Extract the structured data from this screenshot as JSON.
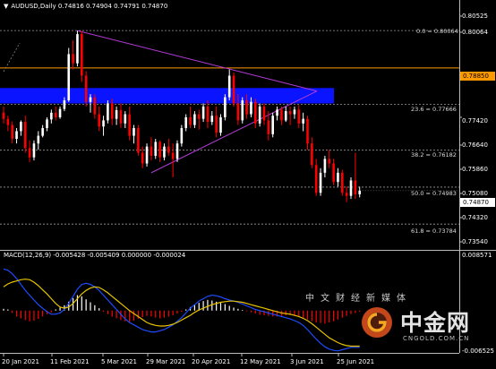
{
  "chart_header": {
    "symbol_timeframe": "AUDUSD,Daily",
    "ohlc": "0.74816 0.74904 0.74791 0.74870"
  },
  "macd_header": "MACD(12,26,9) -0.005428 -0.005409 0.000000 -0.000024",
  "price_axis": {
    "ticks": [
      "0.80525",
      "0.80064",
      "0.78850",
      "0.77420",
      "0.76640",
      "0.75860",
      "0.75080",
      "0.74870",
      "0.74320",
      "0.73540"
    ],
    "current_price": "0.74870",
    "marked_level": "0.78850",
    "marked_level_color": "#ff9900"
  },
  "macd_axis": {
    "top": "0.008571",
    "bottom": "-0.006525"
  },
  "time_axis": [
    "20 Jan 2021",
    "11 Feb 2021",
    "5 Mar 2021",
    "29 Mar 2021",
    "20 Apr 2021",
    "12 May 2021",
    "3 Jun 2021",
    "25 Jun 2021"
  ],
  "fibonacci": [
    {
      "label": "0.0 = 0.80064"
    },
    {
      "label": "23.6 = 0.77666"
    },
    {
      "label": "38.2 = 0.76182"
    },
    {
      "label": "50.0 = 0.74983"
    },
    {
      "label": "61.8 = 0.73784"
    }
  ],
  "colors": {
    "background": "#000000",
    "bull_candle": "#ffffff",
    "bear_candle": "#ff0000",
    "zone": "#0a14ff",
    "triangle": "#b23bd6",
    "macd_signal": "#e6c200",
    "macd_line": "#1e4bff",
    "histogram_pos": "#ffffff",
    "histogram_neg": "#ff0000"
  },
  "watermark": {
    "cn_text": "中文财经新媒体",
    "brand": "中金网",
    "domain": "CNGOLD.COM.CN"
  },
  "chart_data": {
    "type": "candlestick",
    "title": "AUDUSD,Daily",
    "ylim": [
      0.7315,
      0.8065
    ],
    "x": [
      "20 Jan 2021",
      "11 Feb 2021",
      "5 Mar 2021",
      "29 Mar 2021",
      "20 Apr 2021",
      "12 May 2021",
      "3 Jun 2021",
      "25 Jun 2021"
    ],
    "candles": [
      [
        0.774,
        0.776,
        0.7705,
        0.772
      ],
      [
        0.772,
        0.773,
        0.768,
        0.77
      ],
      [
        0.77,
        0.7712,
        0.764,
        0.7655
      ],
      [
        0.7655,
        0.769,
        0.764,
        0.768
      ],
      [
        0.768,
        0.7715,
        0.7665,
        0.771
      ],
      [
        0.771,
        0.773,
        0.761,
        0.7625
      ],
      [
        0.7625,
        0.765,
        0.758,
        0.7595
      ],
      [
        0.7595,
        0.765,
        0.7585,
        0.764
      ],
      [
        0.764,
        0.768,
        0.762,
        0.7665
      ],
      [
        0.7665,
        0.77,
        0.766,
        0.769
      ],
      [
        0.769,
        0.7725,
        0.768,
        0.7718
      ],
      [
        0.7718,
        0.775,
        0.7705,
        0.774
      ],
      [
        0.774,
        0.776,
        0.7715,
        0.7725
      ],
      [
        0.7725,
        0.776,
        0.772,
        0.7752
      ],
      [
        0.7752,
        0.779,
        0.7745,
        0.778
      ],
      [
        0.778,
        0.795,
        0.7775,
        0.793
      ],
      [
        0.793,
        0.7975,
        0.788,
        0.79
      ],
      [
        0.79,
        0.8006,
        0.789,
        0.7995
      ],
      [
        0.7995,
        0.8005,
        0.784,
        0.786
      ],
      [
        0.786,
        0.7875,
        0.776,
        0.7775
      ],
      [
        0.7775,
        0.78,
        0.774,
        0.779
      ],
      [
        0.779,
        0.78,
        0.772,
        0.7735
      ],
      [
        0.7735,
        0.776,
        0.768,
        0.7695
      ],
      [
        0.7695,
        0.773,
        0.7665,
        0.7715
      ],
      [
        0.7715,
        0.778,
        0.7705,
        0.777
      ],
      [
        0.777,
        0.7785,
        0.77,
        0.772
      ],
      [
        0.772,
        0.776,
        0.77,
        0.7748
      ],
      [
        0.7748,
        0.777,
        0.769,
        0.7705
      ],
      [
        0.7705,
        0.7745,
        0.769,
        0.7735
      ],
      [
        0.7735,
        0.776,
        0.765,
        0.7665
      ],
      [
        0.7665,
        0.77,
        0.764,
        0.769
      ],
      [
        0.769,
        0.77,
        0.76,
        0.761
      ],
      [
        0.761,
        0.763,
        0.756,
        0.7575
      ],
      [
        0.7575,
        0.764,
        0.7565,
        0.763
      ],
      [
        0.763,
        0.766,
        0.7585,
        0.76
      ],
      [
        0.76,
        0.7655,
        0.759,
        0.7645
      ],
      [
        0.7645,
        0.765,
        0.758,
        0.7595
      ],
      [
        0.7595,
        0.764,
        0.7585,
        0.763
      ],
      [
        0.763,
        0.7655,
        0.76,
        0.761
      ],
      [
        0.761,
        0.764,
        0.753,
        0.759
      ],
      [
        0.759,
        0.765,
        0.758,
        0.764
      ],
      [
        0.764,
        0.77,
        0.763,
        0.769
      ],
      [
        0.769,
        0.7735,
        0.768,
        0.7725
      ],
      [
        0.7725,
        0.776,
        0.769,
        0.77
      ],
      [
        0.77,
        0.7745,
        0.769,
        0.7735
      ],
      [
        0.7735,
        0.775,
        0.7685,
        0.772
      ],
      [
        0.772,
        0.777,
        0.771,
        0.776
      ],
      [
        0.776,
        0.778,
        0.769,
        0.771
      ],
      [
        0.771,
        0.7745,
        0.77,
        0.773
      ],
      [
        0.773,
        0.776,
        0.766,
        0.7675
      ],
      [
        0.7675,
        0.7735,
        0.7665,
        0.7725
      ],
      [
        0.7725,
        0.78,
        0.7715,
        0.779
      ],
      [
        0.779,
        0.788,
        0.778,
        0.786
      ],
      [
        0.786,
        0.787,
        0.776,
        0.777
      ],
      [
        0.777,
        0.78,
        0.77,
        0.7715
      ],
      [
        0.7715,
        0.779,
        0.7705,
        0.778
      ],
      [
        0.778,
        0.78,
        0.772,
        0.7735
      ],
      [
        0.7735,
        0.779,
        0.7725,
        0.7775
      ],
      [
        0.7775,
        0.7785,
        0.769,
        0.7705
      ],
      [
        0.7705,
        0.777,
        0.7695,
        0.776
      ],
      [
        0.776,
        0.777,
        0.77,
        0.7715
      ],
      [
        0.7715,
        0.7745,
        0.765,
        0.767
      ],
      [
        0.767,
        0.774,
        0.766,
        0.773
      ],
      [
        0.773,
        0.776,
        0.7715,
        0.775
      ],
      [
        0.775,
        0.776,
        0.77,
        0.7715
      ],
      [
        0.7715,
        0.776,
        0.771,
        0.7745
      ],
      [
        0.7745,
        0.776,
        0.77,
        0.7735
      ],
      [
        0.7735,
        0.776,
        0.772,
        0.775
      ],
      [
        0.775,
        0.7765,
        0.769,
        0.7705
      ],
      [
        0.7705,
        0.774,
        0.768,
        0.772
      ],
      [
        0.772,
        0.773,
        0.762,
        0.764
      ],
      [
        0.764,
        0.766,
        0.756,
        0.757
      ],
      [
        0.757,
        0.759,
        0.747,
        0.748
      ],
      [
        0.748,
        0.756,
        0.747,
        0.7545
      ],
      [
        0.7545,
        0.76,
        0.753,
        0.759
      ],
      [
        0.759,
        0.762,
        0.756,
        0.7575
      ],
      [
        0.7575,
        0.759,
        0.7505,
        0.7515
      ],
      [
        0.7515,
        0.756,
        0.75,
        0.7545
      ],
      [
        0.7545,
        0.7555,
        0.747,
        0.748
      ],
      [
        0.748,
        0.75,
        0.745,
        0.747
      ],
      [
        0.747,
        0.753,
        0.746,
        0.752
      ],
      [
        0.752,
        0.761,
        0.746,
        0.7475
      ],
      [
        0.7475,
        0.75,
        0.7465,
        0.7487
      ]
    ],
    "macd_histogram": [
      0.0003,
      0.0002,
      -0.0004,
      -0.001,
      -0.0013,
      -0.0016,
      -0.0018,
      -0.0017,
      -0.0014,
      -0.001,
      -0.0006,
      -0.0003,
      0.0002,
      0.0005,
      0.0009,
      0.0015,
      0.0021,
      0.0026,
      0.0024,
      0.0019,
      0.0014,
      0.0009,
      0.0004,
      -0.0002,
      -0.0006,
      -0.001,
      -0.0013,
      -0.0016,
      -0.0018,
      -0.0019,
      -0.0017,
      -0.0014,
      -0.0011,
      -0.0009,
      -0.001,
      -0.0012,
      -0.0013,
      -0.0012,
      -0.001,
      -0.0008,
      -0.0005,
      -0.0002,
      0.0002,
      0.0006,
      0.001,
      0.0013,
      0.0016,
      0.0018,
      0.0017,
      0.0015,
      0.0013,
      0.0011,
      0.0008,
      0.0005,
      0.0003,
      0.0001,
      -0.0001,
      -0.0003,
      -0.0005,
      -0.0007,
      -0.0008,
      -0.0009,
      -0.001,
      -0.001,
      -0.0009,
      -0.0008,
      -0.0008,
      -0.0009,
      -0.001,
      -0.0012,
      -0.0015,
      -0.0018,
      -0.002,
      -0.0021,
      -0.0022,
      -0.002,
      -0.0018,
      -0.0015,
      -0.0012,
      -0.0009,
      -0.0006,
      -0.0004,
      -0.0002
    ],
    "macd_signal": [
      0.004,
      0.0045,
      0.0048,
      0.005,
      0.0052,
      0.0053,
      0.0052,
      0.0048,
      0.0042,
      0.0035,
      0.0028,
      0.002,
      0.0012,
      0.0006,
      0.0004,
      0.0006,
      0.0012,
      0.002,
      0.0028,
      0.0034,
      0.0038,
      0.004,
      0.0039,
      0.0035,
      0.003,
      0.0024,
      0.0018,
      0.0012,
      0.0006,
      0.0,
      -0.0005,
      -0.001,
      -0.0015,
      -0.002,
      -0.0023,
      -0.0025,
      -0.0026,
      -0.0026,
      -0.0025,
      -0.0023,
      -0.002,
      -0.0016,
      -0.0012,
      -0.0008,
      -0.0003,
      0.0001,
      0.0004,
      0.0007,
      0.001,
      0.0012,
      0.0014,
      0.0015,
      0.0016,
      0.0016,
      0.0015,
      0.0014,
      0.0012,
      0.001,
      0.0008,
      0.0006,
      0.0004,
      0.0002,
      0.0,
      -0.0002,
      -0.0004,
      -0.0005,
      -0.0006,
      -0.0008,
      -0.001,
      -0.0013,
      -0.0017,
      -0.0022,
      -0.0028,
      -0.0034,
      -0.004,
      -0.0046,
      -0.005,
      -0.0054,
      -0.0057,
      -0.0059,
      -0.006,
      -0.006,
      -0.006
    ],
    "macd_line": [
      0.007,
      0.0068,
      0.0062,
      0.0054,
      0.0044,
      0.0034,
      0.0026,
      0.0018,
      0.001,
      0.0004,
      -0.0002,
      -0.0006,
      -0.0006,
      -0.0004,
      0.0002,
      0.0012,
      0.0024,
      0.0036,
      0.0044,
      0.0046,
      0.0044,
      0.004,
      0.0034,
      0.0026,
      0.0018,
      0.001,
      0.0002,
      -0.0006,
      -0.0014,
      -0.002,
      -0.0024,
      -0.0028,
      -0.0032,
      -0.0034,
      -0.0036,
      -0.0036,
      -0.0034,
      -0.0032,
      -0.0028,
      -0.0024,
      -0.0018,
      -0.0012,
      -0.0004,
      0.0004,
      0.001,
      0.0016,
      0.002,
      0.0024,
      0.0026,
      0.0025,
      0.0023,
      0.002,
      0.0018,
      0.0016,
      0.0014,
      0.0011,
      0.0008,
      0.0005,
      0.0002,
      0.0,
      -0.0002,
      -0.0004,
      -0.0006,
      -0.0008,
      -0.001,
      -0.0012,
      -0.0014,
      -0.0017,
      -0.002,
      -0.0025,
      -0.0032,
      -0.004,
      -0.0048,
      -0.0055,
      -0.0061,
      -0.0065,
      -0.0067,
      -0.0068,
      -0.0066,
      -0.0064,
      -0.0062,
      -0.0062,
      -0.0062
    ]
  }
}
